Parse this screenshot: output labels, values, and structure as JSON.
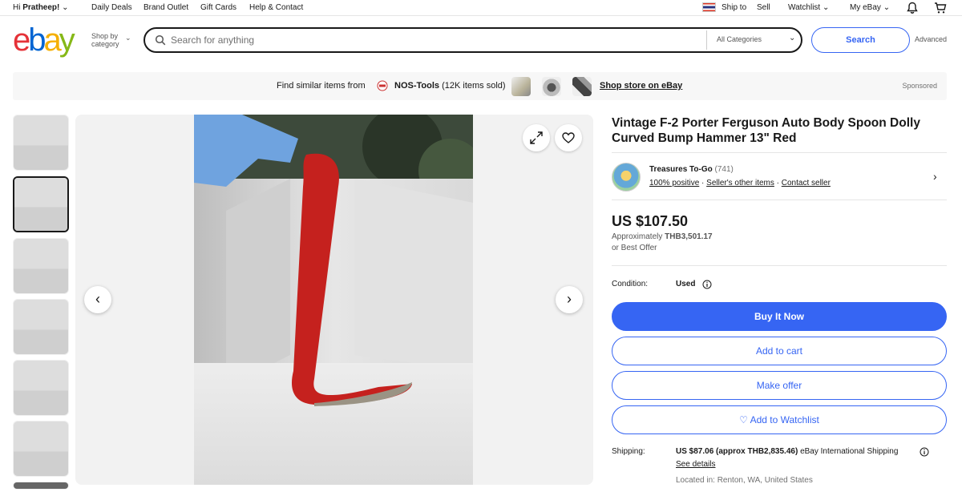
{
  "topnav": {
    "greeting_prefix": "Hi ",
    "user": "Pratheep!",
    "daily_deals": "Daily Deals",
    "brand_outlet": "Brand Outlet",
    "gift_cards": "Gift Cards",
    "help_contact": "Help & Contact",
    "ship_to": "Ship to",
    "sell": "Sell",
    "watchlist": "Watchlist",
    "my_ebay": "My eBay"
  },
  "header": {
    "logo": [
      "e",
      "b",
      "a",
      "y"
    ],
    "shop_by_line1": "Shop by",
    "shop_by_line2": "category",
    "search_placeholder": "Search for anything",
    "category": "All Categories",
    "search_button": "Search",
    "advanced": "Advanced"
  },
  "sponsored": {
    "find_similar": "Find similar items from",
    "store_name": "NOS-Tools",
    "store_sold": "(12K items sold)",
    "shop_store": "Shop store on eBay",
    "label": "Sponsored"
  },
  "listing": {
    "title": "Vintage F-2 Porter Ferguson Auto Body Spoon Dolly Curved Bump Hammer 13\" Red",
    "seller": {
      "name": "Treasures To-Go",
      "feedback_count": "(741)",
      "positive": "100% positive",
      "other_items": "Seller's other items",
      "contact": "Contact seller"
    },
    "price": "US $107.50",
    "approx_prefix": "Approximately",
    "approx_value": "THB3,501.17",
    "best_offer": "or Best Offer",
    "condition_label": "Condition:",
    "condition_value": "Used",
    "buy_now": "Buy It Now",
    "add_to_cart": "Add to cart",
    "make_offer": "Make offer",
    "add_watchlist": "♡ Add to Watchlist",
    "shipping_label": "Shipping:",
    "shipping_value": "US $87.06 (approx THB2,835.46)",
    "shipping_method": "eBay International Shipping",
    "see_details": "See details",
    "located": "Located in: Renton, WA, United States"
  },
  "colors": {
    "accent": "#3665f3",
    "logo_e": "#e53238",
    "logo_b": "#0064d2",
    "logo_a": "#f5af02",
    "logo_y": "#86b817"
  }
}
